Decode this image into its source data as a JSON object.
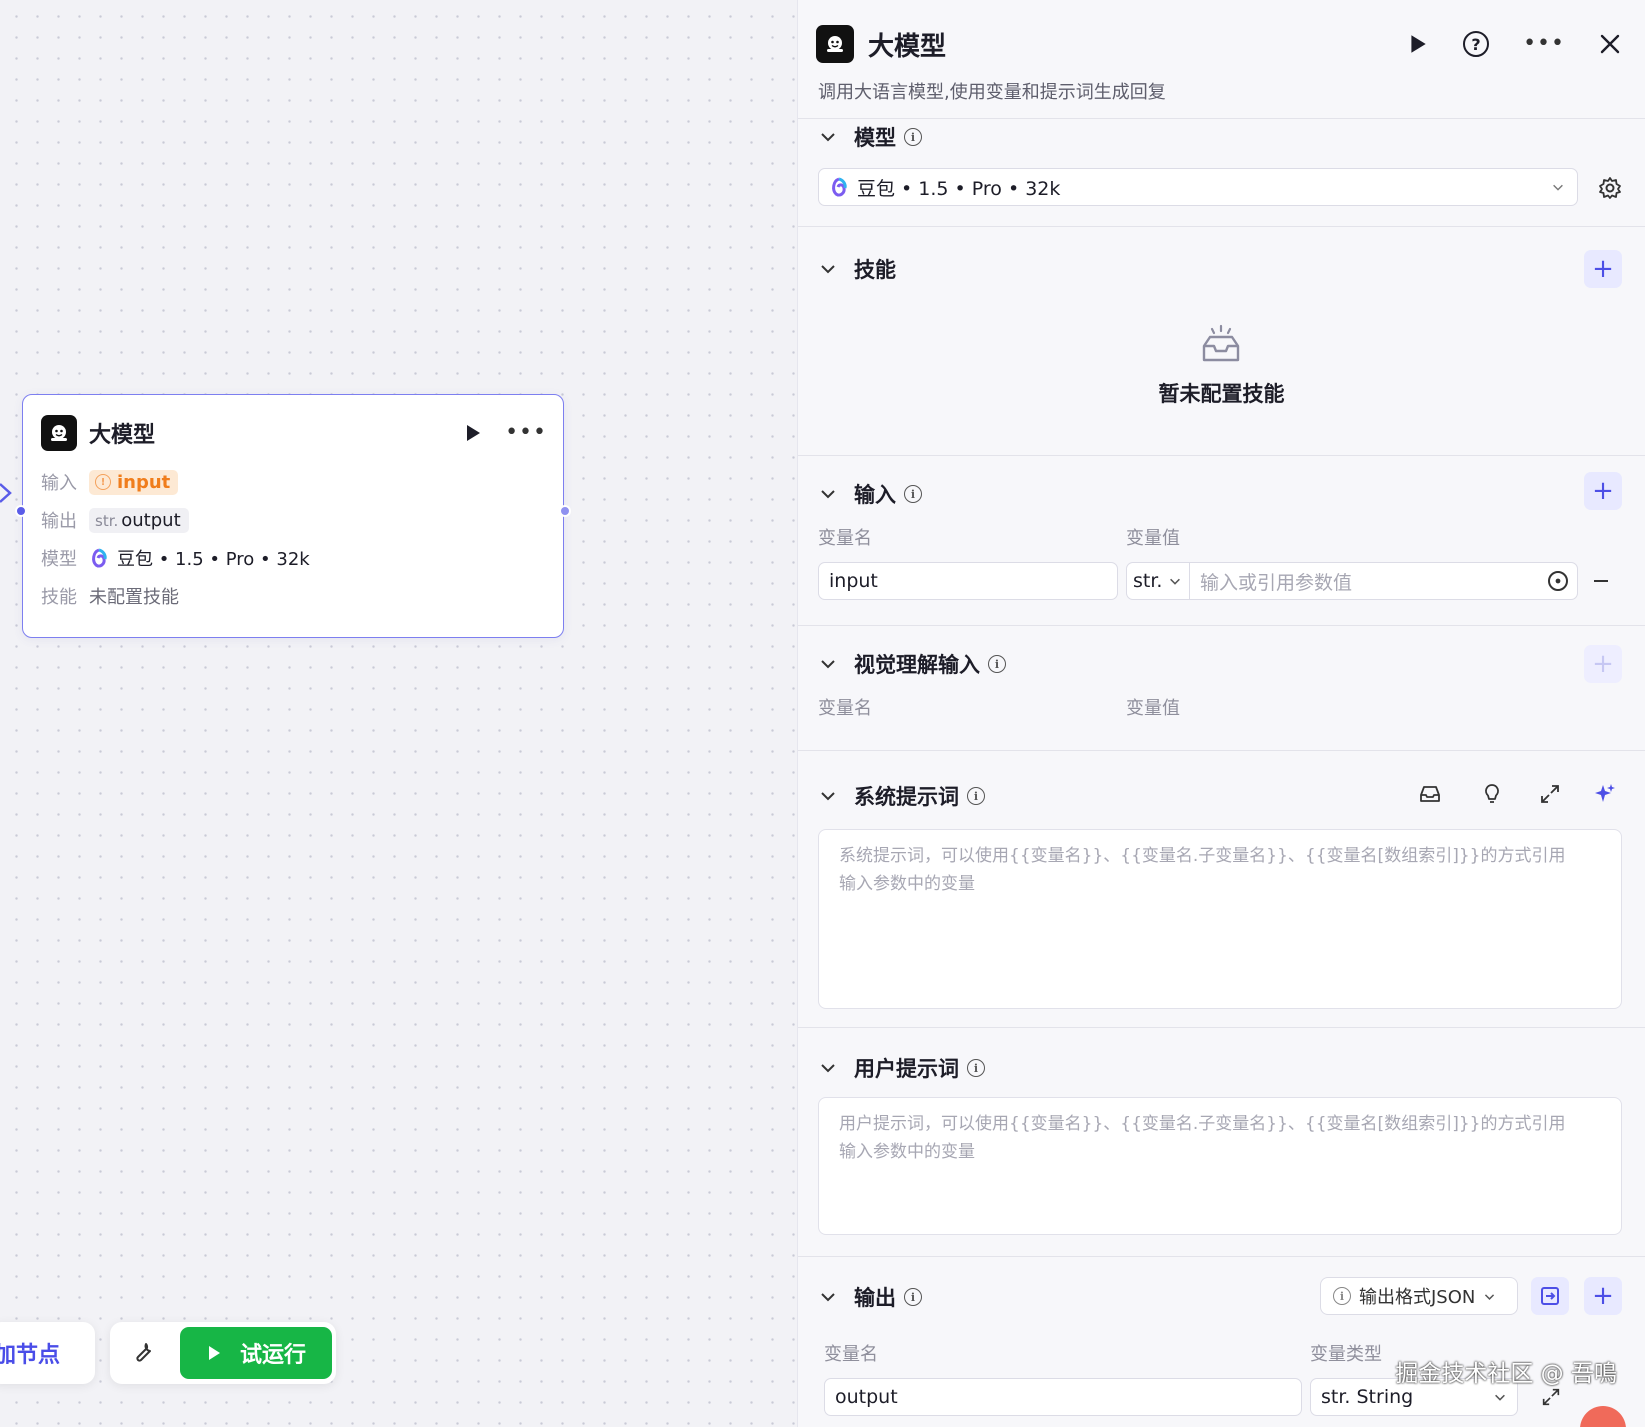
{
  "node": {
    "title": "大模型",
    "rows": [
      {
        "label": "输入",
        "value": "input"
      },
      {
        "label": "输出",
        "type": "str.",
        "value": "output"
      },
      {
        "label": "模型",
        "value": "豆包 • 1.5 • Pro • 32k"
      },
      {
        "label": "技能",
        "value": "未配置技能"
      }
    ]
  },
  "bottom_bar": {
    "add_node_label": "加节点",
    "run_label": "试运行"
  },
  "panel": {
    "title": "大模型",
    "description": "调用大语言模型,使用变量和提示词生成回复",
    "model_section": {
      "title": "模型",
      "selected_model": "豆包 • 1.5 • Pro • 32k"
    },
    "skills_section": {
      "title": "技能",
      "empty_text": "暂未配置技能"
    },
    "input_section": {
      "title": "输入",
      "col_name": "变量名",
      "col_value": "变量值",
      "row_name": "input",
      "row_type": "str.",
      "value_placeholder": "输入或引用参数值"
    },
    "vision_section": {
      "title": "视觉理解输入",
      "col_name": "变量名",
      "col_value": "变量值"
    },
    "system_prompt": {
      "title": "系统提示词",
      "placeholder_line1": "系统提示词，可以使用{{变量名}}、{{变量名.子变量名}}、{{变量名[数组索引]}}的方式引用",
      "placeholder_line2": "输入参数中的变量"
    },
    "user_prompt": {
      "title": "用户提示词",
      "placeholder_line1": "用户提示词，可以使用{{变量名}}、{{变量名.子变量名}}、{{变量名[数组索引]}}的方式引用",
      "placeholder_line2": "输入参数中的变量"
    },
    "output_section": {
      "title": "输出",
      "format_label": "输出格式JSON",
      "col_name": "变量名",
      "col_type": "变量类型",
      "row_name": "output",
      "row_type": "str. String"
    }
  },
  "watermark": "掘金技术社区 @ 吾鳴",
  "colors": {
    "accent": "#4d4fe6",
    "run_green": "#17b646",
    "input_tag_text": "#f07d1c",
    "node_border": "#7d7ff0"
  },
  "icons": [
    "bot-icon",
    "play-icon",
    "more-icon",
    "help-icon",
    "close-icon",
    "info-icon",
    "chevron-down-icon",
    "gear-icon",
    "plus-icon",
    "minus-icon",
    "variable-picker-icon",
    "library-icon",
    "lightbulb-icon",
    "expand-icon",
    "sparkle-icon",
    "wrench-icon",
    "doubao-logo-icon",
    "empty-box-icon"
  ]
}
